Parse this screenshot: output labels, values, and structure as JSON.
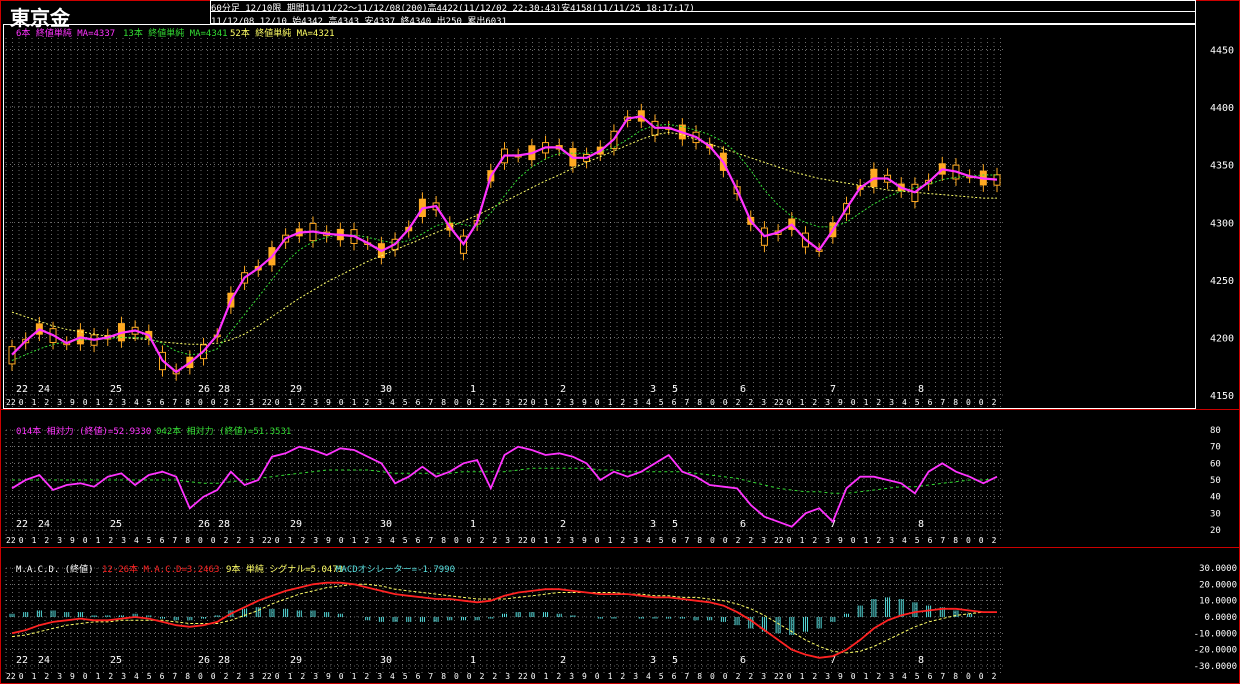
{
  "header": {
    "title": "東京金",
    "line1": "60分足 12/10限 期間11/11/22～11/12/08(200)高4422(11/12/02 22:30:43)安4158(11/11/25 18:17:17)",
    "line2": "11/12/08 12/10 始4342 高4343 安4337 終4340 出250 累出6031"
  },
  "colors": {
    "bg": "#000000",
    "grid": "#ffffff",
    "border": "#cc0000",
    "magenta": "#ff33ff",
    "green": "#33dd33",
    "yellow": "#ffff66",
    "orange": "#ffaa22",
    "red": "#ff2222",
    "cyan": "#55dddd"
  },
  "date_axis": {
    "labels": [
      "22",
      "24",
      "25",
      "26",
      "28",
      "29",
      "30",
      "1",
      "2",
      "3",
      "5",
      "6",
      "7",
      "8"
    ],
    "hour_row": [
      "22",
      "0",
      "1",
      "2",
      "3",
      "9",
      "0",
      "1",
      "2",
      "3",
      "4",
      "5",
      "6",
      "7",
      "8",
      "0",
      "0",
      "2",
      "2",
      "3"
    ]
  },
  "chart_data": [
    {
      "type": "candlestick",
      "legend": [
        "6本 終値単純 MA=4337",
        "13本 終値単純 MA=4341",
        "52本 終値単純 MA=4321"
      ],
      "ylim": [
        4150,
        4460
      ],
      "yticks": [
        4150,
        4200,
        4250,
        4300,
        4350,
        4400,
        4450
      ],
      "ma6": [
        4185,
        4197,
        4207,
        4202,
        4195,
        4200,
        4198,
        4200,
        4204,
        4206,
        4202,
        4180,
        4170,
        4178,
        4188,
        4202,
        4232,
        4252,
        4260,
        4270,
        4286,
        4291,
        4292,
        4290,
        4289,
        4288,
        4282,
        4275,
        4281,
        4294,
        4312,
        4314,
        4296,
        4281,
        4300,
        4340,
        4358,
        4358,
        4360,
        4365,
        4365,
        4356,
        4356,
        4362,
        4372,
        4390,
        4392,
        4382,
        4382,
        4378,
        4374,
        4366,
        4352,
        4328,
        4301,
        4288,
        4291,
        4298,
        4285,
        4276,
        4293,
        4312,
        4330,
        4338,
        4338,
        4330,
        4326,
        4335,
        4346,
        4344,
        4340,
        4338,
        4337
      ],
      "ma13": [
        4180,
        4185,
        4190,
        4194,
        4196,
        4198,
        4198,
        4199,
        4200,
        4200,
        4199,
        4195,
        4188,
        4185,
        4186,
        4190,
        4205,
        4220,
        4235,
        4250,
        4265,
        4276,
        4283,
        4287,
        4289,
        4289,
        4287,
        4284,
        4282,
        4284,
        4290,
        4297,
        4300,
        4298,
        4296,
        4308,
        4323,
        4338,
        4348,
        4355,
        4360,
        4360,
        4360,
        4361,
        4365,
        4372,
        4380,
        4384,
        4385,
        4383,
        4380,
        4376,
        4370,
        4360,
        4345,
        4328,
        4315,
        4305,
        4300,
        4296,
        4296,
        4300,
        4308,
        4316,
        4322,
        4327,
        4330,
        4333,
        4337,
        4339,
        4340,
        4341,
        4341
      ],
      "ma52": [
        4222,
        4218,
        4214,
        4210,
        4207,
        4205,
        4203,
        4201,
        4200,
        4199,
        4198,
        4196,
        4195,
        4194,
        4194,
        4195,
        4198,
        4203,
        4210,
        4218,
        4226,
        4234,
        4241,
        4248,
        4254,
        4260,
        4266,
        4271,
        4276,
        4281,
        4286,
        4291,
        4296,
        4301,
        4306,
        4312,
        4318,
        4324,
        4330,
        4336,
        4341,
        4347,
        4352,
        4357,
        4362,
        4367,
        4372,
        4376,
        4378,
        4376,
        4372,
        4368,
        4364,
        4360,
        4356,
        4352,
        4348,
        4344,
        4341,
        4338,
        4336,
        4334,
        4332,
        4330,
        4328,
        4327,
        4326,
        4325,
        4324,
        4323,
        4322,
        4321,
        4321
      ]
    },
    {
      "type": "line",
      "legend": [
        "014本 相対力 (終値)=52.9330",
        "042本 相対力 (終値)=51.3531"
      ],
      "ylim": [
        20,
        80
      ],
      "yticks": [
        20,
        30,
        40,
        50,
        60,
        70,
        80
      ],
      "series": [
        {
          "values": [
            45,
            50,
            53,
            44,
            47,
            48,
            46,
            52,
            54,
            47,
            53,
            55,
            52,
            33,
            40,
            44,
            55,
            47,
            50,
            64,
            66,
            70,
            68,
            65,
            69,
            68,
            64,
            60,
            48,
            52,
            58,
            52,
            55,
            60,
            62,
            45,
            65,
            70,
            68,
            65,
            66,
            64,
            60,
            50,
            55,
            52,
            55,
            60,
            65,
            55,
            52,
            47,
            46,
            45,
            35,
            28,
            25,
            22,
            30,
            33,
            25,
            45,
            52,
            52,
            50,
            48,
            42,
            55,
            60,
            55,
            52,
            48,
            52
          ]
        },
        {
          "values": [
            50,
            50,
            50,
            50,
            50,
            50,
            50,
            50,
            50,
            50,
            50,
            50,
            50,
            49,
            48,
            48,
            49,
            50,
            51,
            52,
            53,
            54,
            55,
            56,
            56,
            56,
            56,
            55,
            54,
            54,
            54,
            54,
            54,
            55,
            55,
            55,
            55,
            56,
            57,
            57,
            57,
            57,
            57,
            56,
            56,
            55,
            55,
            55,
            55,
            55,
            54,
            53,
            52,
            51,
            49,
            47,
            45,
            44,
            43,
            43,
            42,
            42,
            43,
            44,
            45,
            46,
            46,
            47,
            48,
            49,
            50,
            50,
            51
          ]
        }
      ]
    },
    {
      "type": "macd",
      "legend_main": "M.A.C.D. (終値)",
      "legend_macd": "12-26本 M.A.C.D=3.2463",
      "legend_signal": "9本 単純 シグナル=5.0473",
      "legend_osc": "MACDオシレーター=-1.7990",
      "ylim": [
        -30,
        30
      ],
      "yticks": [
        "30.0000",
        "20.0000",
        "10.0000",
        "0.0000",
        "-10.0000",
        "-20.0000",
        "-30.0000"
      ],
      "macd": [
        -10,
        -8,
        -5,
        -3,
        -2,
        -1,
        -2,
        -2,
        -1,
        0,
        -1,
        -3,
        -5,
        -6,
        -5,
        -3,
        2,
        6,
        10,
        13,
        16,
        18,
        20,
        21,
        21,
        20,
        18,
        16,
        14,
        13,
        12,
        11,
        11,
        10,
        9,
        10,
        13,
        15,
        16,
        17,
        17,
        16,
        15,
        14,
        14,
        14,
        13,
        12,
        12,
        11,
        10,
        9,
        7,
        3,
        -2,
        -8,
        -14,
        -20,
        -23,
        -25,
        -24,
        -20,
        -14,
        -7,
        -2,
        1,
        3,
        4,
        5,
        5,
        4,
        3,
        3
      ],
      "signal": [
        -12,
        -11,
        -9,
        -7,
        -5,
        -4,
        -3,
        -3,
        -2,
        -2,
        -2,
        -2,
        -3,
        -4,
        -4,
        -4,
        -2,
        1,
        4,
        8,
        11,
        14,
        16,
        18,
        19,
        20,
        20,
        19,
        17,
        16,
        15,
        14,
        13,
        12,
        11,
        11,
        11,
        12,
        13,
        14,
        15,
        15,
        15,
        15,
        15,
        14,
        14,
        13,
        13,
        12,
        12,
        11,
        10,
        8,
        5,
        1,
        -4,
        -9,
        -14,
        -18,
        -21,
        -22,
        -21,
        -18,
        -14,
        -10,
        -6,
        -3,
        -1,
        1,
        2,
        3,
        3
      ],
      "osc": [
        2,
        3,
        4,
        4,
        3,
        3,
        1,
        1,
        1,
        2,
        1,
        -1,
        -2,
        -2,
        -1,
        1,
        4,
        5,
        6,
        5,
        5,
        4,
        4,
        3,
        2,
        0,
        -2,
        -3,
        -3,
        -3,
        -3,
        -3,
        -2,
        -2,
        -2,
        -1,
        2,
        3,
        3,
        3,
        2,
        1,
        0,
        -1,
        -1,
        0,
        -1,
        -1,
        -1,
        -1,
        -2,
        -2,
        -3,
        -5,
        -7,
        -9,
        -10,
        -11,
        -9,
        -7,
        -3,
        2,
        7,
        11,
        12,
        11,
        9,
        7,
        6,
        4,
        2,
        0,
        0
      ]
    }
  ]
}
